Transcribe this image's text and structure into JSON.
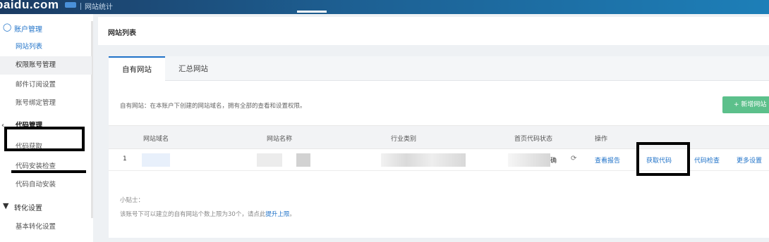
{
  "topbar": {
    "brand": "baidu.com",
    "product": "网站统计"
  },
  "sidebar": {
    "groups": [
      {
        "label": "账户管理",
        "icon": "user-icon",
        "items": [
          {
            "label": "网站列表",
            "state": "active"
          },
          {
            "label": "权限账号管理",
            "state": "highlighted"
          },
          {
            "label": "邮件订阅设置",
            "state": "normal"
          },
          {
            "label": "账号绑定管理",
            "state": "normal"
          }
        ]
      },
      {
        "label": "代码管理",
        "icon": "chevron-left-icon",
        "items": [
          {
            "label": "代码获取",
            "state": "normal"
          },
          {
            "label": "代码安装检查",
            "state": "normal"
          },
          {
            "label": "代码自动安装",
            "state": "normal"
          }
        ]
      },
      {
        "label": "转化设置",
        "icon": "filter-icon",
        "items": [
          {
            "label": "基本转化设置",
            "state": "normal"
          }
        ]
      }
    ]
  },
  "main": {
    "page_title": "网站列表",
    "tabs": [
      {
        "label": "自有网站",
        "active": true
      },
      {
        "label": "汇总网站",
        "active": false
      }
    ],
    "description": "自有网站：在本账户下创建的网站域名，拥有全部的查看和设置权限。",
    "add_button": "+ 新增网站",
    "table": {
      "headers": [
        "网站域名",
        "网站名称",
        "行业类别",
        "首页代码状态",
        "操作"
      ],
      "rows": [
        {
          "index": "1",
          "status_suffix": "确",
          "actions": [
            "查看报告",
            "获取代码",
            "代码检查",
            "更多设置"
          ]
        }
      ]
    },
    "tips": {
      "title": "小贴士：",
      "body": "该账号下可以建立的自有网站个数上限为30个，请点此",
      "link": "提升上限",
      "end": "。"
    }
  },
  "colors": {
    "accent": "#1f72c8",
    "add_button": "#5cc08b",
    "topbar": "#1d5f92"
  }
}
